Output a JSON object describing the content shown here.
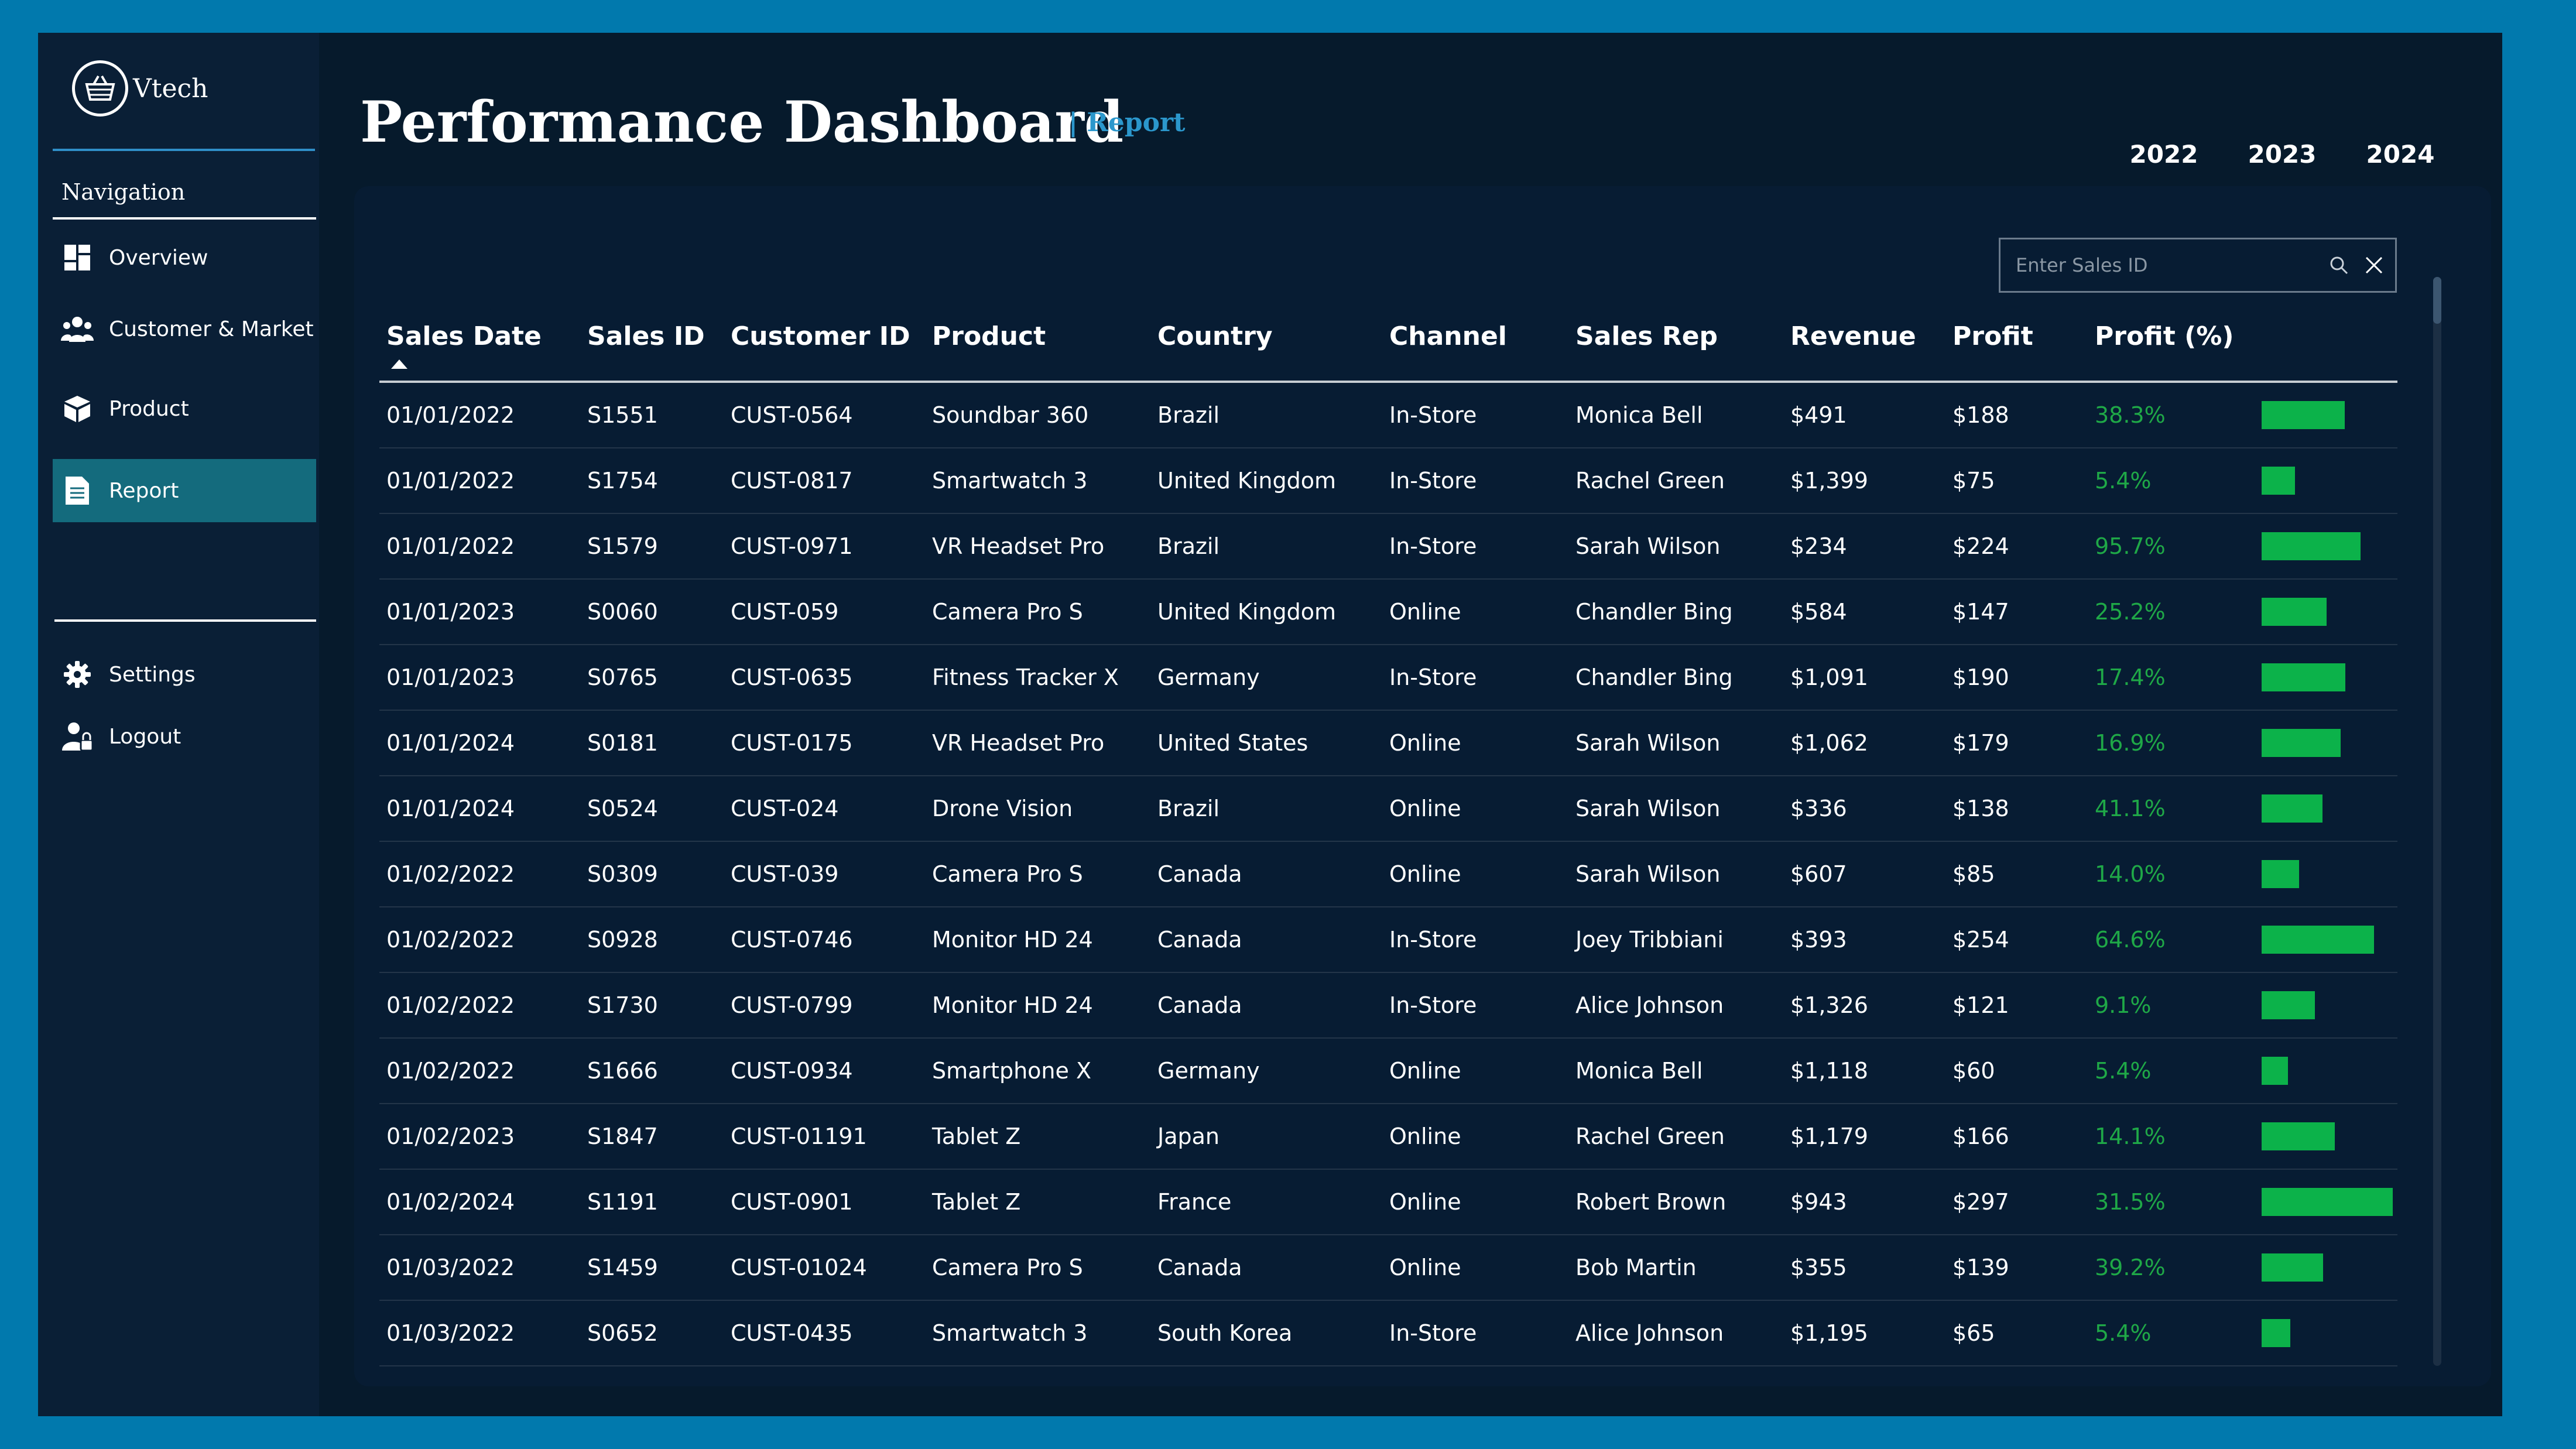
{
  "app": {
    "name": "Vtech"
  },
  "sidebar": {
    "nav_title": "Navigation",
    "items": [
      {
        "label": "Overview",
        "icon": "dashboard-icon"
      },
      {
        "label": "Customer & Market",
        "icon": "users-icon"
      },
      {
        "label": "Product",
        "icon": "box-icon"
      },
      {
        "label": "Report",
        "icon": "document-icon",
        "active": true
      }
    ],
    "bottom_items": [
      {
        "label": "Settings",
        "icon": "gear-icon"
      },
      {
        "label": "Logout",
        "icon": "logout-user-icon"
      }
    ]
  },
  "header": {
    "title": "Performance Dashboard",
    "subtitle": "| Report",
    "years": [
      "2022",
      "2023",
      "2024"
    ]
  },
  "search": {
    "placeholder": "Enter Sales ID"
  },
  "colors": {
    "accent": "#2b97cc",
    "active_nav": "#146b7d",
    "bar": "#0cb24a",
    "pct_text": "#1fa847"
  },
  "table": {
    "sort_column": "Sales Date",
    "columns": [
      "Sales Date",
      "Sales ID",
      "Customer ID",
      "Product",
      "Country",
      "Channel",
      "Sales Rep",
      "Revenue",
      "Profit",
      "Profit (%)"
    ],
    "rows": [
      {
        "date": "01/01/2022",
        "id": "S1551",
        "customer": "CUST-0564",
        "product": "Soundbar 360",
        "country": "Brazil",
        "channel": "In-Store",
        "rep": "Monica Bell",
        "revenue": "$491",
        "profit": "$188",
        "pct": "38.3%",
        "profit_value": 188
      },
      {
        "date": "01/01/2022",
        "id": "S1754",
        "customer": "CUST-0817",
        "product": "Smartwatch 3",
        "country": "United Kingdom",
        "channel": "In-Store",
        "rep": "Rachel Green",
        "revenue": "$1,399",
        "profit": "$75",
        "pct": "5.4%",
        "profit_value": 75
      },
      {
        "date": "01/01/2022",
        "id": "S1579",
        "customer": "CUST-0971",
        "product": "VR Headset Pro",
        "country": "Brazil",
        "channel": "In-Store",
        "rep": "Sarah Wilson",
        "revenue": "$234",
        "profit": "$224",
        "pct": "95.7%",
        "profit_value": 224
      },
      {
        "date": "01/01/2023",
        "id": "S0060",
        "customer": "CUST-059",
        "product": "Camera Pro S",
        "country": "United Kingdom",
        "channel": "Online",
        "rep": "Chandler Bing",
        "revenue": "$584",
        "profit": "$147",
        "pct": "25.2%",
        "profit_value": 147
      },
      {
        "date": "01/01/2023",
        "id": "S0765",
        "customer": "CUST-0635",
        "product": "Fitness Tracker X",
        "country": "Germany",
        "channel": "In-Store",
        "rep": "Chandler Bing",
        "revenue": "$1,091",
        "profit": "$190",
        "pct": "17.4%",
        "profit_value": 190
      },
      {
        "date": "01/01/2024",
        "id": "S0181",
        "customer": "CUST-0175",
        "product": "VR Headset Pro",
        "country": "United States",
        "channel": "Online",
        "rep": "Sarah Wilson",
        "revenue": "$1,062",
        "profit": "$179",
        "pct": "16.9%",
        "profit_value": 179
      },
      {
        "date": "01/01/2024",
        "id": "S0524",
        "customer": "CUST-024",
        "product": "Drone Vision",
        "country": "Brazil",
        "channel": "Online",
        "rep": "Sarah Wilson",
        "revenue": "$336",
        "profit": "$138",
        "pct": "41.1%",
        "profit_value": 138
      },
      {
        "date": "01/02/2022",
        "id": "S0309",
        "customer": "CUST-039",
        "product": "Camera Pro S",
        "country": "Canada",
        "channel": "Online",
        "rep": "Sarah Wilson",
        "revenue": "$607",
        "profit": "$85",
        "pct": "14.0%",
        "profit_value": 85
      },
      {
        "date": "01/02/2022",
        "id": "S0928",
        "customer": "CUST-0746",
        "product": "Monitor HD 24",
        "country": "Canada",
        "channel": "In-Store",
        "rep": "Joey Tribbiani",
        "revenue": "$393",
        "profit": "$254",
        "pct": "64.6%",
        "profit_value": 254
      },
      {
        "date": "01/02/2022",
        "id": "S1730",
        "customer": "CUST-0799",
        "product": "Monitor HD 24",
        "country": "Canada",
        "channel": "In-Store",
        "rep": "Alice Johnson",
        "revenue": "$1,326",
        "profit": "$121",
        "pct": "9.1%",
        "profit_value": 121
      },
      {
        "date": "01/02/2022",
        "id": "S1666",
        "customer": "CUST-0934",
        "product": "Smartphone X",
        "country": "Germany",
        "channel": "Online",
        "rep": "Monica Bell",
        "revenue": "$1,118",
        "profit": "$60",
        "pct": "5.4%",
        "profit_value": 60
      },
      {
        "date": "01/02/2023",
        "id": "S1847",
        "customer": "CUST-01191",
        "product": "Tablet Z",
        "country": "Japan",
        "channel": "Online",
        "rep": "Rachel Green",
        "revenue": "$1,179",
        "profit": "$166",
        "pct": "14.1%",
        "profit_value": 166
      },
      {
        "date": "01/02/2024",
        "id": "S1191",
        "customer": "CUST-0901",
        "product": "Tablet Z",
        "country": "France",
        "channel": "Online",
        "rep": "Robert Brown",
        "revenue": "$943",
        "profit": "$297",
        "pct": "31.5%",
        "profit_value": 297
      },
      {
        "date": "01/03/2022",
        "id": "S1459",
        "customer": "CUST-01024",
        "product": "Camera Pro S",
        "country": "Canada",
        "channel": "Online",
        "rep": "Bob Martin",
        "revenue": "$355",
        "profit": "$139",
        "pct": "39.2%",
        "profit_value": 139
      },
      {
        "date": "01/03/2022",
        "id": "S0652",
        "customer": "CUST-0435",
        "product": "Smartwatch 3",
        "country": "South Korea",
        "channel": "In-Store",
        "rep": "Alice Johnson",
        "revenue": "$1,195",
        "profit": "$65",
        "pct": "5.4%",
        "profit_value": 65
      }
    ]
  }
}
